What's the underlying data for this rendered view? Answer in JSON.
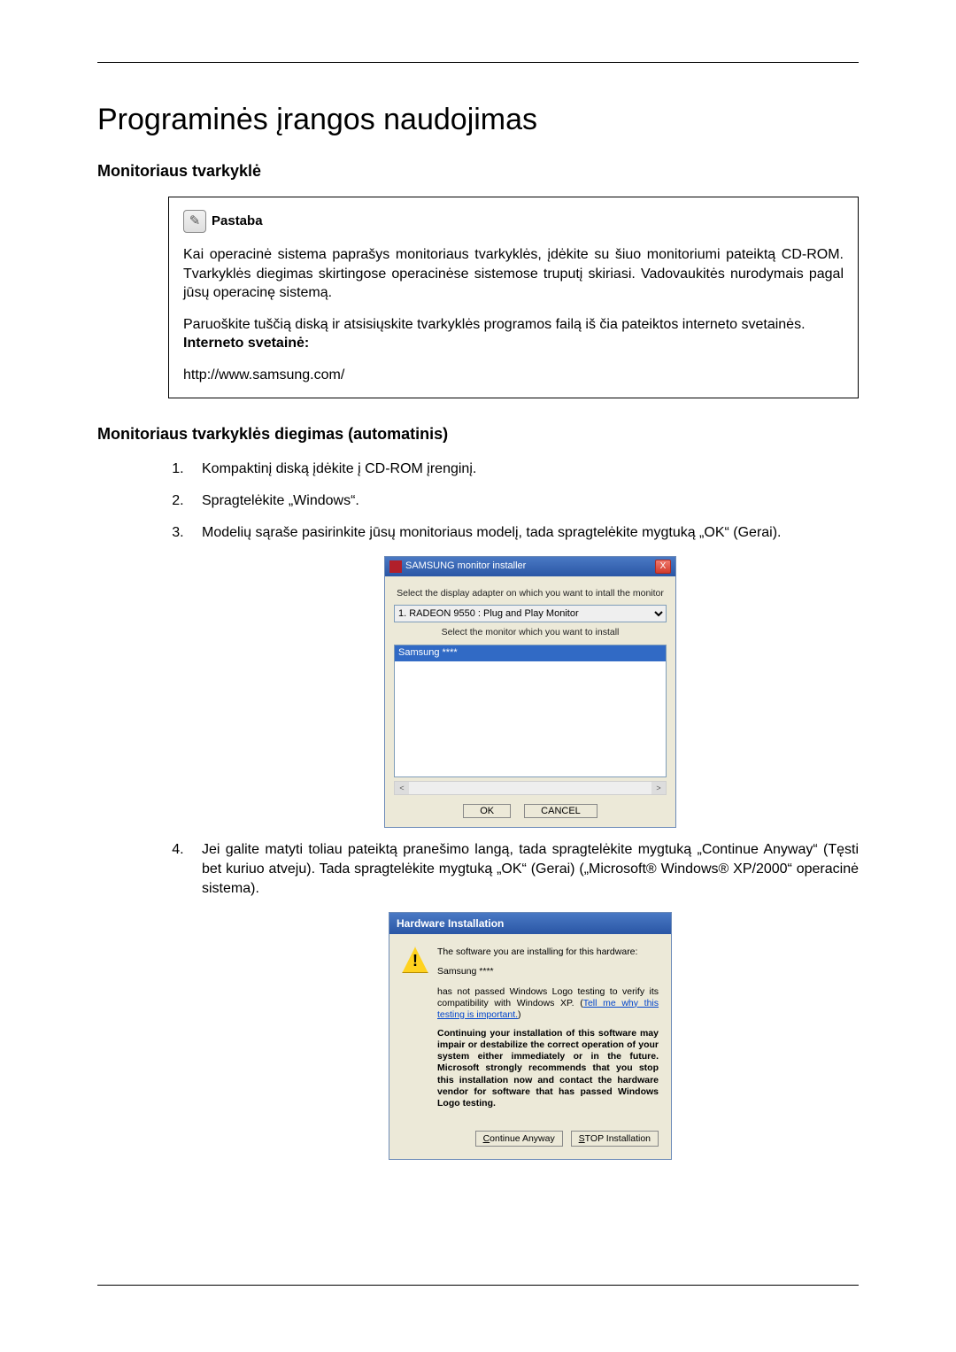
{
  "title": "Programinės įrangos naudojimas",
  "section1": {
    "heading": "Monitoriaus tvarkyklė",
    "note_label": "Pastaba",
    "note_para1": "Kai operacinė sistema paprašys monitoriaus tvarkyklės, įdėkite su šiuo monitoriumi pateiktą CD-ROM. Tvarkyklės diegimas skirtingose operacinėse sistemose truputį skiriasi. Vadovaukitės nurodymais pagal jūsų operacinę sistemą.",
    "note_para2": "Paruoškite tuščią diską ir atsisiųskite tvarkyklės programos failą iš čia pateiktos interneto svetainės.",
    "site_label": "Interneto svetainė:",
    "site_url": "http://www.samsung.com/"
  },
  "section2": {
    "heading": "Monitoriaus tvarkyklės diegimas (automatinis)",
    "step1": "Kompaktinį diską įdėkite į CD-ROM įrenginį.",
    "step2": "Spragtelėkite „Windows“.",
    "step3": "Modelių sąraše pasirinkite jūsų monitoriaus modelį, tada spragtelėkite mygtuką „OK“ (Gerai).",
    "step4": "Jei galite matyti toliau pateiktą pranešimo langą, tada spragtelėkite mygtuką „Continue Anyway“ (Tęsti bet kuriuo atveju). Tada spragtelėkite mygtuką „OK“ (Gerai) („Microsoft® Windows® XP/2000“ operacinė sistema)."
  },
  "win1": {
    "title": "SAMSUNG monitor installer",
    "close": "X",
    "label_adapter": "Select the display adapter on which you want to intall the monitor",
    "adapter_value": "1. RADEON 9550 : Plug and Play Monitor",
    "label_monitor": "Select the monitor which you want to install",
    "monitor_selected": "Samsung ****",
    "scroll_left": "<",
    "scroll_right": ">",
    "btn_ok": "OK",
    "btn_cancel": "CANCEL"
  },
  "win2": {
    "title": "Hardware Installation",
    "line1": "The software you are installing for this hardware:",
    "devname": "Samsung ****",
    "line2_pre": "has not passed Windows Logo testing to verify its compatibility with Windows XP. (",
    "tell_link": "Tell me why this testing is important.",
    "line2_post": ")",
    "bold_block": "Continuing your installation of this software may impair or destabilize the correct operation of your system either immediately or in the future. Microsoft strongly recommends that you stop this installation now and contact the hardware vendor for software that has passed Windows Logo testing.",
    "btn_continue_u": "C",
    "btn_continue_rest": "ontinue Anyway",
    "btn_stop_u": "S",
    "btn_stop_rest": "TOP Installation",
    "warn_glyph": "!"
  }
}
